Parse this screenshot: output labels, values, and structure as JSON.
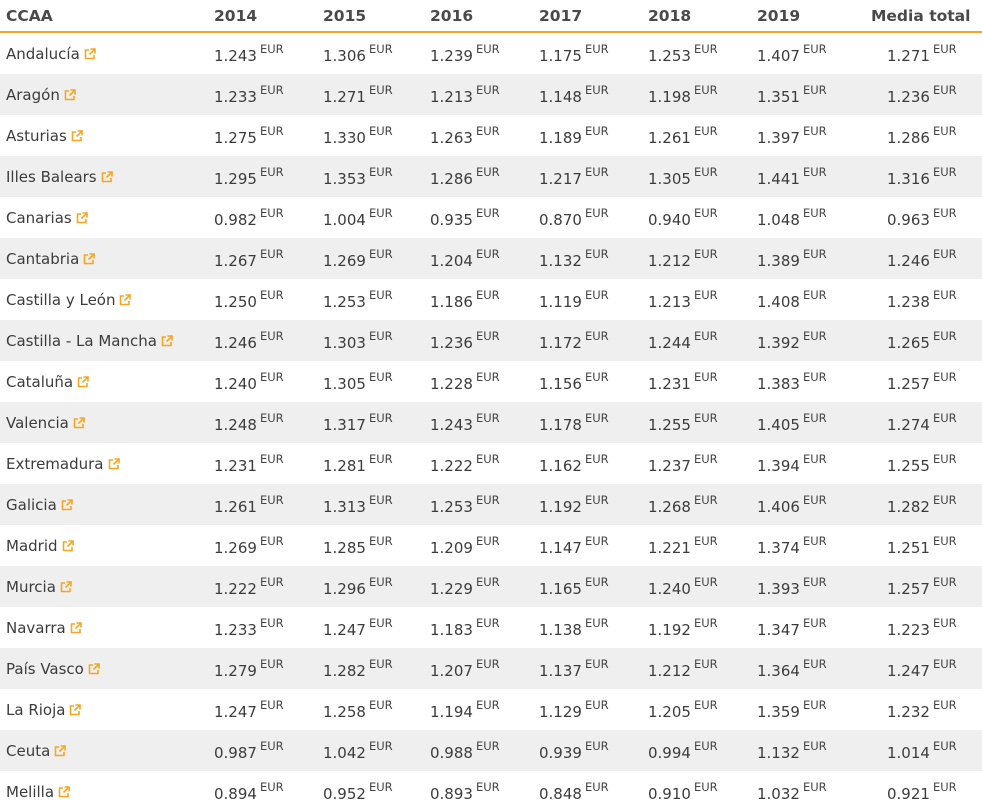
{
  "table": {
    "headers": [
      "CCAA",
      "2014",
      "2015",
      "2016",
      "2017",
      "2018",
      "2019",
      "Media total"
    ],
    "unit": "EUR",
    "rows": [
      {
        "region": "Andalucía",
        "values": [
          "1.243",
          "1.306",
          "1.239",
          "1.175",
          "1.253",
          "1.407",
          "1.271"
        ]
      },
      {
        "region": "Aragón",
        "values": [
          "1.233",
          "1.271",
          "1.213",
          "1.148",
          "1.198",
          "1.351",
          "1.236"
        ]
      },
      {
        "region": "Asturias",
        "values": [
          "1.275",
          "1.330",
          "1.263",
          "1.189",
          "1.261",
          "1.397",
          "1.286"
        ]
      },
      {
        "region": "Illes Balears",
        "values": [
          "1.295",
          "1.353",
          "1.286",
          "1.217",
          "1.305",
          "1.441",
          "1.316"
        ]
      },
      {
        "region": "Canarias",
        "values": [
          "0.982",
          "1.004",
          "0.935",
          "0.870",
          "0.940",
          "1.048",
          "0.963"
        ]
      },
      {
        "region": "Cantabria",
        "values": [
          "1.267",
          "1.269",
          "1.204",
          "1.132",
          "1.212",
          "1.389",
          "1.246"
        ]
      },
      {
        "region": "Castilla y León",
        "values": [
          "1.250",
          "1.253",
          "1.186",
          "1.119",
          "1.213",
          "1.408",
          "1.238"
        ]
      },
      {
        "region": "Castilla - La Mancha",
        "values": [
          "1.246",
          "1.303",
          "1.236",
          "1.172",
          "1.244",
          "1.392",
          "1.265"
        ]
      },
      {
        "region": "Cataluña",
        "values": [
          "1.240",
          "1.305",
          "1.228",
          "1.156",
          "1.231",
          "1.383",
          "1.257"
        ]
      },
      {
        "region": "Valencia",
        "values": [
          "1.248",
          "1.317",
          "1.243",
          "1.178",
          "1.255",
          "1.405",
          "1.274"
        ]
      },
      {
        "region": "Extremadura",
        "values": [
          "1.231",
          "1.281",
          "1.222",
          "1.162",
          "1.237",
          "1.394",
          "1.255"
        ]
      },
      {
        "region": "Galicia",
        "values": [
          "1.261",
          "1.313",
          "1.253",
          "1.192",
          "1.268",
          "1.406",
          "1.282"
        ]
      },
      {
        "region": "Madrid",
        "values": [
          "1.269",
          "1.285",
          "1.209",
          "1.147",
          "1.221",
          "1.374",
          "1.251"
        ]
      },
      {
        "region": "Murcia",
        "values": [
          "1.222",
          "1.296",
          "1.229",
          "1.165",
          "1.240",
          "1.393",
          "1.257"
        ]
      },
      {
        "region": "Navarra",
        "values": [
          "1.233",
          "1.247",
          "1.183",
          "1.138",
          "1.192",
          "1.347",
          "1.223"
        ]
      },
      {
        "region": "País Vasco",
        "values": [
          "1.279",
          "1.282",
          "1.207",
          "1.137",
          "1.212",
          "1.364",
          "1.247"
        ]
      },
      {
        "region": "La Rioja",
        "values": [
          "1.247",
          "1.258",
          "1.194",
          "1.129",
          "1.205",
          "1.359",
          "1.232"
        ]
      },
      {
        "region": "Ceuta",
        "values": [
          "0.987",
          "1.042",
          "0.988",
          "0.939",
          "0.994",
          "1.132",
          "1.014"
        ]
      },
      {
        "region": "Melilla",
        "values": [
          "0.894",
          "0.952",
          "0.893",
          "0.848",
          "0.910",
          "1.032",
          "0.921"
        ]
      }
    ]
  },
  "icons": {
    "external_link": "external-link-icon"
  },
  "colors": {
    "accent": "#f5a623",
    "stripe": "#efefef"
  }
}
